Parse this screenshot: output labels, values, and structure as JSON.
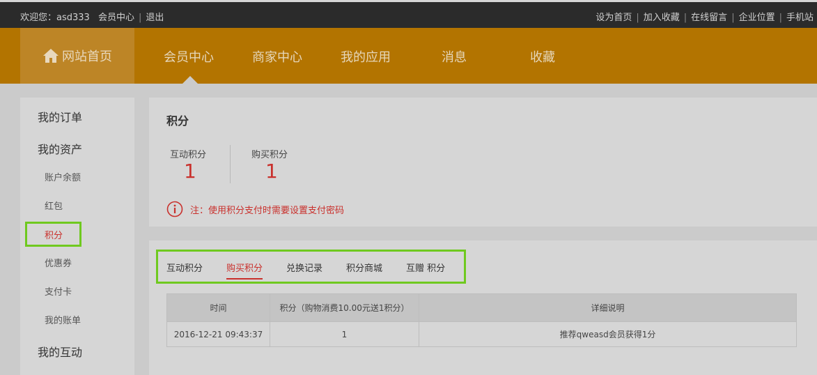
{
  "topbar": {
    "welcome": "欢迎您：asd333",
    "member_center": "会员中心",
    "logout": "退出",
    "links": [
      "设为首页",
      "加入收藏",
      "在线留言",
      "企业位置",
      "手机站"
    ]
  },
  "nav": {
    "home": "网站首页",
    "items": [
      "会员中心",
      "商家中心",
      "我的应用",
      "消息",
      "收藏"
    ]
  },
  "sidebar": {
    "orders": "我的订单",
    "assets": "我的资产",
    "sub": [
      "账户余额",
      "红包",
      "积分",
      "优惠券",
      "支付卡",
      "我的账单"
    ],
    "interaction": "我的互动"
  },
  "points": {
    "title": "积分",
    "interactive_label": "互动积分",
    "interactive_value": "1",
    "purchase_label": "购买积分",
    "purchase_value": "1",
    "notice": "注：使用积分支付时需要设置支付密码"
  },
  "tabs": [
    "互动积分",
    "购买积分",
    "兑换记录",
    "积分商城",
    "互赠 积分"
  ],
  "table": {
    "headers": [
      "时间",
      "积分（购物消费10.00元送1积分）",
      "详细说明"
    ],
    "rows": [
      [
        "2016-12-21 09:43:37",
        "1",
        "推荐qweasd会员获得1分"
      ]
    ]
  },
  "colors": {
    "nav_bg": "#b37400",
    "accent_red": "#c9302c",
    "highlight_green": "#6fc91f"
  }
}
